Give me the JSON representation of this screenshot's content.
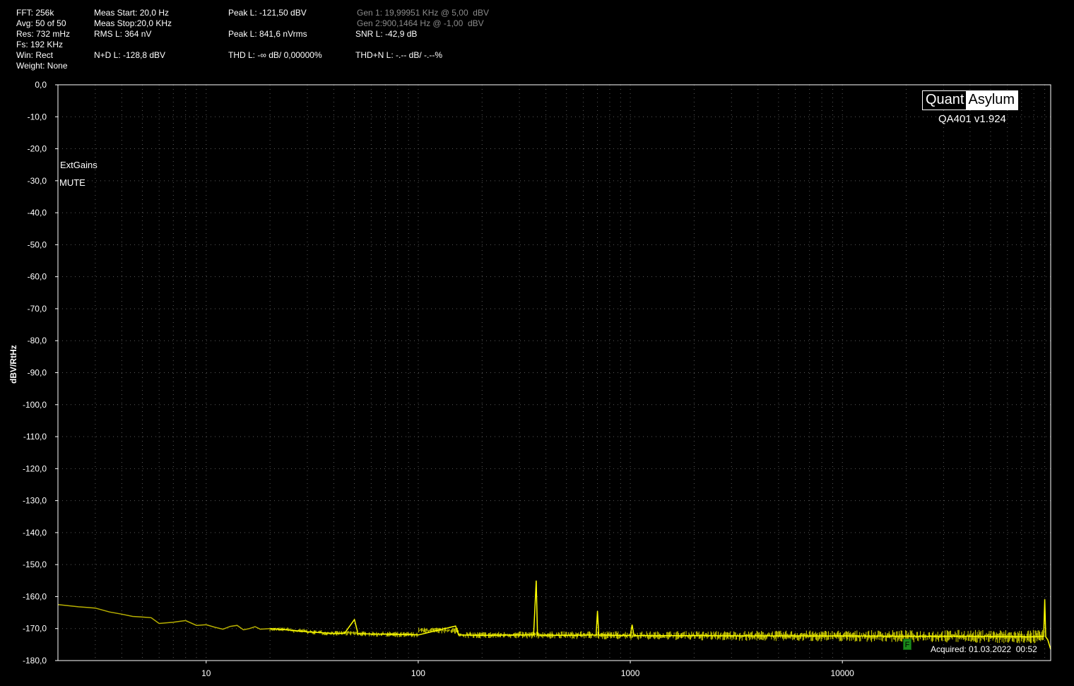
{
  "stats": {
    "fft": "FFT: 256k",
    "avg": "Avg: 50 of 50",
    "res": "Res: 732 mHz",
    "fs": "Fs: 192 KHz",
    "win": "Win: Rect",
    "weight": "Weight: None",
    "meas_start": "Meas Start: 20,0 Hz",
    "meas_stop": "Meas Stop:20,0 KHz",
    "rms_l": "RMS L: 364 nV",
    "nd_l": "N+D L: -128,8 dBV",
    "peak_l_dbv": "Peak L: -121,50 dBV",
    "peak_l_vrms": "Peak L: 841,6 nVrms",
    "thd_l": "THD L: -∞ dB/ 0,00000%",
    "gen1": "Gen 1: 19,99951 KHz @ 5,00  dBV",
    "gen2": "Gen 2:900,1464 Hz @ -1,00  dBV",
    "snr_l": "SNR L: -42,9 dB",
    "thdn_l": "THD+N L: -.-- dB/ -.--%"
  },
  "logo": {
    "left": "Quant",
    "right": "Asylum",
    "version": "QA401 v1.924"
  },
  "overlay": {
    "extgains": "ExtGains",
    "mute": "MUTE",
    "acquired": "Acquired: 01.03.2022  00:52",
    "marker": "F"
  },
  "colors": {
    "background": "#000000",
    "grid": "#5a5a5a",
    "trace": "#ffff00",
    "trace_low": "#b8b000",
    "axis_text": "#ffffff",
    "marker": "#1a8a1a"
  },
  "chart_data": {
    "type": "line",
    "xscale": "log",
    "xlim": [
      2,
      96000
    ],
    "ylim": [
      -180,
      0
    ],
    "ylabel": "dBV/RtHz",
    "x_tick_labels": [
      "10",
      "100",
      "1000",
      "10000"
    ],
    "x_ticks": [
      10,
      100,
      1000,
      10000
    ],
    "y_ticks": [
      0,
      -10,
      -20,
      -30,
      -40,
      -50,
      -60,
      -70,
      -80,
      -90,
      -100,
      -110,
      -120,
      -130,
      -140,
      -150,
      -160,
      -170,
      -180
    ],
    "y_tick_labels": [
      "0,0",
      "-10,0",
      "-20,0",
      "-30,0",
      "-40,0",
      "-50,0",
      "-60,0",
      "-70,0",
      "-80,0",
      "-90,0",
      "-100,0",
      "-110,0",
      "-120,0",
      "-130,0",
      "-140,0",
      "-150,0",
      "-160,0",
      "-170,0",
      "-180,0"
    ],
    "grid": true,
    "series": [
      {
        "points": [
          [
            2,
            -162.5
          ],
          [
            2.5,
            -163.2
          ],
          [
            3,
            -163.6
          ],
          [
            3.5,
            -164.8
          ],
          [
            4,
            -165.5
          ],
          [
            4.5,
            -166.2
          ],
          [
            5,
            -166.4
          ],
          [
            5.5,
            -166.6
          ],
          [
            6,
            -168.4
          ],
          [
            7,
            -168.0
          ],
          [
            8,
            -167.5
          ],
          [
            9,
            -169.0
          ],
          [
            10,
            -168.8
          ],
          [
            11,
            -169.6
          ],
          [
            12,
            -170.2
          ],
          [
            13,
            -169.3
          ],
          [
            14,
            -169.0
          ],
          [
            15,
            -170.4
          ],
          [
            16,
            -170.0
          ],
          [
            17,
            -169.4
          ],
          [
            18,
            -170.2
          ],
          [
            20,
            -170.0
          ],
          [
            25,
            -170.5
          ],
          [
            30,
            -171.0
          ],
          [
            35,
            -171.3
          ],
          [
            40,
            -171.5
          ],
          [
            45,
            -171.4
          ],
          [
            50,
            -167.2
          ],
          [
            52,
            -171.6
          ],
          [
            60,
            -171.7
          ],
          [
            80,
            -171.8
          ],
          [
            100,
            -172.0
          ],
          [
            150,
            -169.2
          ],
          [
            155,
            -172.0
          ],
          [
            200,
            -172.1
          ],
          [
            300,
            -172.0
          ],
          [
            350,
            -172.0
          ],
          [
            360,
            -155.0
          ],
          [
            365,
            -172.0
          ],
          [
            500,
            -172.1
          ],
          [
            690,
            -172.0
          ],
          [
            700,
            -164.5
          ],
          [
            710,
            -172.0
          ],
          [
            1000,
            -172.2
          ],
          [
            1020,
            -168.8
          ],
          [
            1040,
            -172.2
          ],
          [
            2000,
            -172.2
          ],
          [
            5000,
            -172.3
          ],
          [
            10000,
            -172.3
          ],
          [
            20000,
            -172.4
          ],
          [
            40000,
            -172.4
          ],
          [
            60000,
            -172.5
          ],
          [
            80000,
            -172.6
          ],
          [
            89000,
            -172.4
          ],
          [
            90000,
            -160.8
          ],
          [
            91000,
            -172.6
          ],
          [
            93000,
            -173.5
          ],
          [
            96000,
            -176.5
          ]
        ]
      }
    ]
  }
}
